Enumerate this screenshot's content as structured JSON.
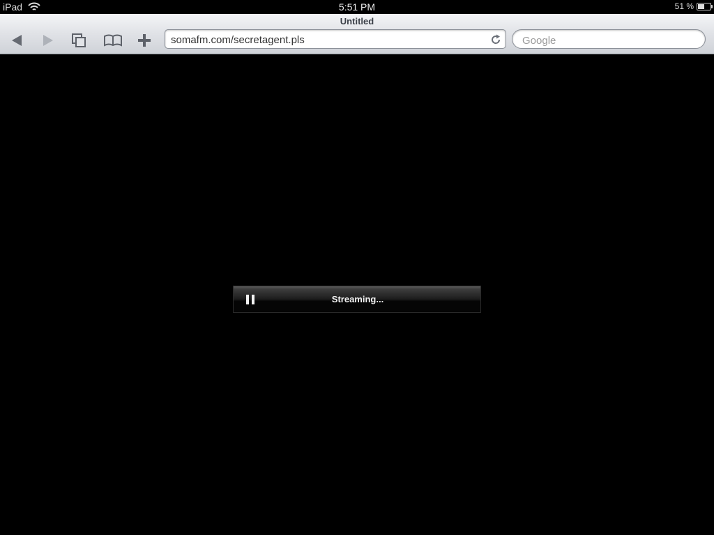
{
  "status_bar": {
    "device": "iPad",
    "time": "5:51 PM",
    "battery_text": "51 %",
    "battery_level": 0.51,
    "wifi_icon": "wifi-icon",
    "battery_icon": "battery-icon"
  },
  "browser": {
    "title": "Untitled",
    "url": "somafm.com/secretagent.pls",
    "search_placeholder": "Google",
    "toolbar_icons": [
      "back-icon",
      "forward-icon",
      "pages-icon",
      "bookmarks-icon",
      "add-icon",
      "reload-icon"
    ]
  },
  "player": {
    "status": "Streaming...",
    "control_icon": "pause-icon"
  },
  "colors": {
    "chrome_top": "#f4f5f7",
    "chrome_bottom": "#cfd2d8",
    "content_bg": "#000000",
    "title_text": "#3a3f47"
  }
}
